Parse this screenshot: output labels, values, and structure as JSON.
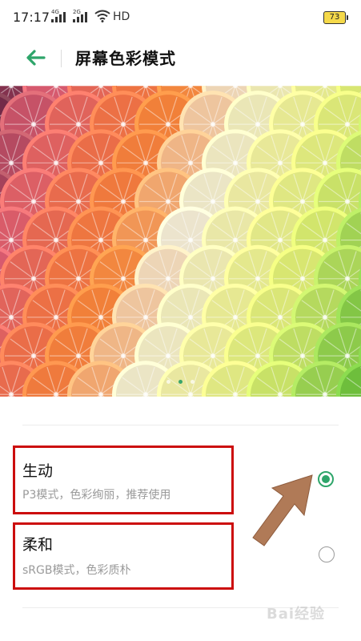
{
  "status_bar": {
    "time": "17:17",
    "signal1_tag": "4G",
    "signal2_tag": "2G",
    "network": "HD",
    "battery": "73"
  },
  "header": {
    "back_icon": "back-arrow-icon",
    "title": "屏幕色彩模式",
    "accent_color": "#2ea56a"
  },
  "hero": {
    "image": "citrus-slices-gradient",
    "page_count": 3,
    "active_page": 1
  },
  "options": [
    {
      "title": "生动",
      "description": "P3模式，色彩绚丽，推荐使用",
      "selected": true
    },
    {
      "title": "柔和",
      "description": "sRGB模式，色彩质朴",
      "selected": false
    }
  ],
  "annotation": {
    "frame_color": "#cc0d0d",
    "arrow_color": "#b07a57"
  },
  "watermark": "Bai经验"
}
